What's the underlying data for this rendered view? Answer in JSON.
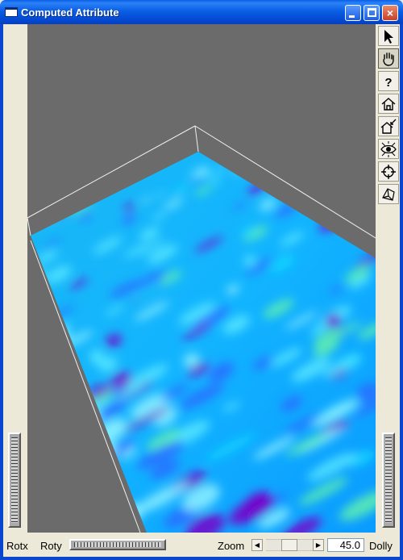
{
  "window": {
    "title": "Computed Attribute",
    "controls": {
      "minimize": "minimize",
      "maximize": "maximize",
      "close": "×"
    }
  },
  "toolbar": {
    "tools": [
      {
        "name": "select",
        "icon": "arrow-pointer-icon",
        "active": false
      },
      {
        "name": "view",
        "icon": "hand-icon",
        "active": true
      },
      {
        "name": "help",
        "icon": "question-icon",
        "active": false
      },
      {
        "name": "home",
        "icon": "home-icon",
        "active": false
      },
      {
        "name": "set-home",
        "icon": "set-home-icon",
        "active": false
      },
      {
        "name": "view-all",
        "icon": "eye-icon",
        "active": false
      },
      {
        "name": "seek",
        "icon": "crosshair-icon",
        "active": false
      },
      {
        "name": "projection",
        "icon": "perspective-cube-icon",
        "active": false
      }
    ]
  },
  "bottom": {
    "rotx_label": "Rotx",
    "roty_label": "Roty",
    "zoom_label": "Zoom",
    "zoom_value": "45.0",
    "dolly_label": "Dolly",
    "scroll_left": "◀",
    "scroll_right": "▶"
  },
  "scene": {
    "background_color": "#6b6b6b",
    "bbox_color": "#f0f0f0",
    "colormap": [
      "#7a00c8",
      "#2b6bff",
      "#1ab8f5",
      "#0ad2ff",
      "#57e8ff",
      "#8ef0ff",
      "#5ff0b0"
    ]
  }
}
